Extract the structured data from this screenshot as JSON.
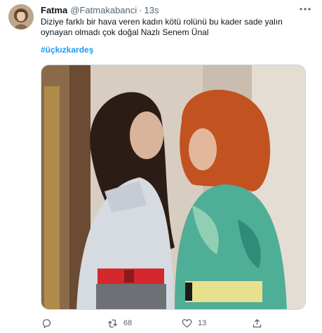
{
  "tweet": {
    "author_name": "Fatma",
    "author_handle": "@Fatmakabanci",
    "separator": "·",
    "timestamp": "13s",
    "body": "Diziye farklı bir hava veren kadın kötü rolünü bu kader sade yalın oynayan olmadı çok doğal Nazlı Senem Ünal",
    "hashtag": "#üçkızkardeş",
    "media": {
      "description_icon": "photo"
    },
    "actions": {
      "reply_count": "",
      "retweet_count": "68",
      "like_count": "13",
      "share_count": ""
    }
  },
  "colors": {
    "text_primary": "#0f1419",
    "text_secondary": "#536471",
    "link": "#1d9bf0",
    "border": "#cfd9de"
  }
}
